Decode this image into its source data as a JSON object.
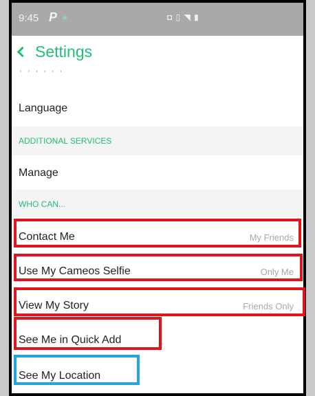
{
  "status_bar": {
    "time": "9:45",
    "app_glyph": "P",
    "icons": "◘ ▯ ◥ ▮"
  },
  "nav": {
    "back_icon": "chevron-left-icon",
    "title": "Settings"
  },
  "partial_label": "' ' ' ' ' '",
  "rows": {
    "language": {
      "label": "Language"
    },
    "additional_services": {
      "header": "ADDITIONAL SERVICES"
    },
    "manage": {
      "label": "Manage"
    },
    "who_can": {
      "header": "WHO CAN..."
    },
    "contact_me": {
      "label": "Contact Me",
      "value": "My Friends"
    },
    "cameos": {
      "label": "Use My Cameos Selfie",
      "value": "Only Me"
    },
    "story": {
      "label": "View My Story",
      "value": "Friends Only"
    },
    "quick_add": {
      "label": "See Me in Quick Add"
    },
    "location": {
      "label": "See My Location"
    }
  },
  "colors": {
    "accent": "#1fbf73",
    "highlight_red": "#e0151b",
    "highlight_blue": "#21a5e3"
  }
}
